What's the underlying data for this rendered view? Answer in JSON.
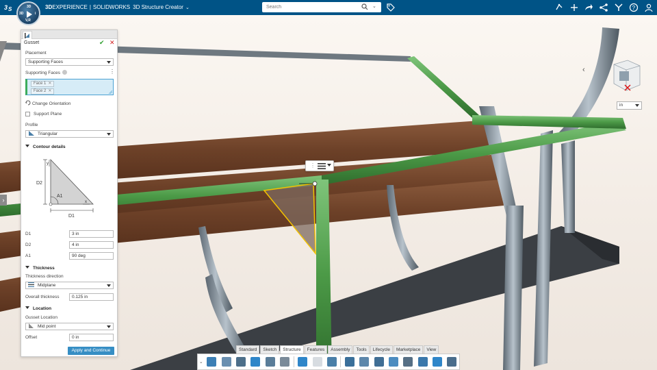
{
  "topbar": {
    "platform_bold": "3D",
    "platform_rest": "EXPERIENCE",
    "separator": "|",
    "product": "SOLIDWORKS",
    "app_name": "3D Structure Creator",
    "search_placeholder": "Search",
    "compass": {
      "top": "3D",
      "left": "3D",
      "right": "i",
      "bottom": "V,R"
    },
    "icons": [
      "ds-logo-icon",
      "compass-icon",
      "search-icon",
      "tag-icon",
      "share-icon",
      "add-icon",
      "forward-icon",
      "network-icon",
      "tools-icon",
      "help-icon",
      "user-icon"
    ],
    "brand_color": "#005386"
  },
  "panel": {
    "title": "Gusset",
    "ok_symbol": "✔",
    "cancel_symbol": "✕",
    "placement_label": "Placement",
    "placement_value": "Supporting Faces",
    "supporting_faces_label": "Supporting Faces",
    "faces": [
      "Face 1",
      "Face 2"
    ],
    "change_orientation": "Change Orientation",
    "support_plane": "Support Plane",
    "profile_label": "Profile",
    "profile_value": "Triangular",
    "contour_section": "Contour details",
    "diagram_labels": {
      "d2": "D2",
      "a1": "A1",
      "d1": "D1",
      "x": "x",
      "y": "y"
    },
    "d1_label": "D1",
    "d1_value": "3 in",
    "d2_label": "D2",
    "d2_value": "4 in",
    "a1_label": "A1",
    "a1_value": "90 deg",
    "thickness_section": "Thickness",
    "thickness_direction_label": "Thickness direction",
    "thickness_direction_value": "Midplane",
    "overall_thickness_label": "Overall thickness",
    "overall_thickness_value": "0.125 in",
    "location_section": "Location",
    "gusset_location_label": "Gusset Location",
    "gusset_location_value": "Mid point",
    "offset_label": "Offset",
    "offset_value": "0 in",
    "apply_button": "Apply and Continue"
  },
  "viewport": {
    "units_value": "in",
    "back_symbol": "‹",
    "side_arrow": "›"
  },
  "action_tabs": [
    "Standard",
    "Sketch",
    "Structure",
    "Features",
    "Assembly",
    "Tools",
    "Lifecycle",
    "Marketplace",
    "View"
  ],
  "active_tab": "Structure",
  "action_icons": [
    "structure-icon",
    "frame-icon",
    "member-icon",
    "trim-icon",
    "gusset-tool-icon",
    "settings-icon",
    "undo-icon",
    "redo-icon",
    "help-tool-icon",
    "rotate-view-icon",
    "view-orientation-icon",
    "display-style-icon",
    "section-icon",
    "measure-icon",
    "view-icon",
    "appearance-icon",
    "render-icon"
  ]
}
